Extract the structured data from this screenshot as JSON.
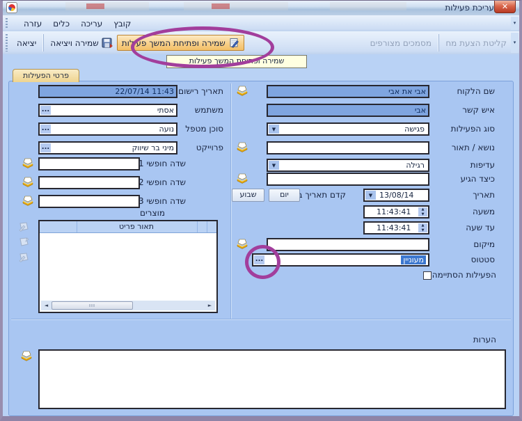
{
  "window": {
    "title": "עריכת פעילות",
    "close_glyph": "✕"
  },
  "menu": {
    "items": [
      {
        "label": "קובץ"
      },
      {
        "label": "עריכה"
      },
      {
        "label": "כלים"
      },
      {
        "label": "עזרה"
      }
    ]
  },
  "toolbar": {
    "exit": "יציאה",
    "save_exit": "שמירה ויציאה",
    "save_open_followup": "שמירה ופתיחת המשך פעילות",
    "attached_documents": "מסמכים מצורפים",
    "receive_quote": "קליטת הצעת מחיר"
  },
  "tooltip": {
    "text": "שמירה ופתיחת המשך פעילות"
  },
  "tab": {
    "label": "פרטי הפעילות"
  },
  "form_right": {
    "customer": {
      "label": "שם הלקוח",
      "value": "אבי את אבי"
    },
    "contact": {
      "label": "איש קשר",
      "value": "אבי"
    },
    "activity_type": {
      "label": "סוג הפעילות",
      "value": "פגישה"
    },
    "subject": {
      "label": "נושא / תאור",
      "value": ""
    },
    "priority": {
      "label": "עדיפות",
      "value": "רגילה"
    },
    "how_arrived": {
      "label": "כיצד הגיע",
      "value": ""
    },
    "date": {
      "label": "תאריך",
      "value": "13/08/14",
      "advance_label": "קדם תאריך ב",
      "day_button": "יום",
      "week_button": "שבוע"
    },
    "from_time": {
      "label": "משעה",
      "value": "11:43:41"
    },
    "to_time": {
      "label": "עד שעה",
      "value": "11:43:41"
    },
    "location": {
      "label": "מיקום",
      "value": ""
    },
    "status": {
      "label": "סטטוס",
      "value": "מעוניין",
      "ellipsis_button": "..."
    },
    "finished": {
      "label": "הפעילות הסתיימה",
      "checked": false
    }
  },
  "form_left": {
    "registered": {
      "label": "תאריך רישום",
      "value": "22/07/14 11:43"
    },
    "user": {
      "label": "משתמש",
      "value": "אסתי",
      "ellipsis_button": "..."
    },
    "agent": {
      "label": "סוכן מטפל",
      "value": "נועה",
      "ellipsis_button": "..."
    },
    "project": {
      "label": "פרוייקט",
      "value": "מיני בר שיווק",
      "ellipsis_button": "..."
    },
    "free1": {
      "label": "שדה חופשי 1"
    },
    "free2": {
      "label": "שדה חופשי 2"
    },
    "free3": {
      "label": "שדה חופשי 3"
    },
    "products": {
      "label": "מוצרים",
      "column_header": "תאור פריט"
    }
  },
  "notes": {
    "label": "הערות"
  },
  "icons": {
    "combo_arrow": "▼",
    "spinner_up": "▲",
    "spinner_down": "▼",
    "scroll_left": "◄",
    "scroll_right": "►",
    "overflow_arrow": "▼"
  },
  "colors": {
    "annotation": "#a23e9c",
    "highlight_button": "#f7cd85",
    "selection": "#3c77cf",
    "readonly_field": "#7fa5e0"
  }
}
